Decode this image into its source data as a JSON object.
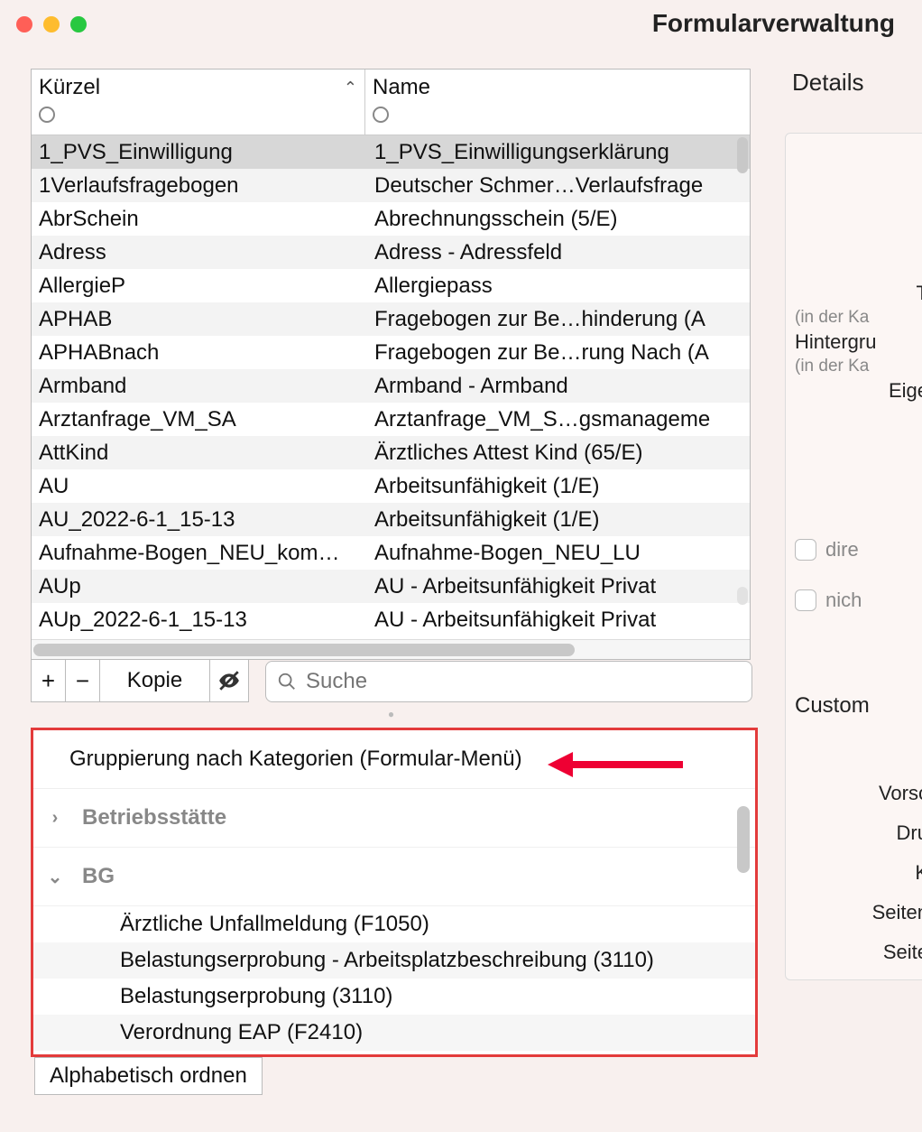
{
  "window": {
    "title": "Formularverwaltung"
  },
  "table": {
    "columns": {
      "kurzel": "Kürzel",
      "name": "Name"
    },
    "rows": [
      {
        "k": "1_PVS_Einwilligung",
        "n": "1_PVS_Einwilligungserklärung",
        "selected": true
      },
      {
        "k": "1Verlaufsfragebogen",
        "n": "Deutscher Schmer…Verlaufsfrage"
      },
      {
        "k": "AbrSchein",
        "n": "Abrechnungsschein (5/E)"
      },
      {
        "k": "Adress",
        "n": "Adress - Adressfeld"
      },
      {
        "k": "AllergieP",
        "n": "Allergiepass"
      },
      {
        "k": "APHAB",
        "n": "Fragebogen zur Be…hinderung (A"
      },
      {
        "k": "APHABnach",
        "n": "Fragebogen zur Be…rung Nach (A"
      },
      {
        "k": "Armband",
        "n": "Armband - Armband"
      },
      {
        "k": "Arztanfrage_VM_SA",
        "n": "Arztanfrage_VM_S…gsmanageme"
      },
      {
        "k": "AttKind",
        "n": "Ärztliches Attest Kind (65/E)"
      },
      {
        "k": "AU",
        "n": "Arbeitsunfähigkeit (1/E)"
      },
      {
        "k": "AU_2022-6-1_15-13",
        "n": "Arbeitsunfähigkeit (1/E)"
      },
      {
        "k": "Aufnahme-Bogen_NEU_kom…",
        "n": "Aufnahme-Bogen_NEU_LU"
      },
      {
        "k": "AUp",
        "n": "AU - Arbeitsunfähigkeit Privat"
      },
      {
        "k": "AUp_2022-6-1_15-13",
        "n": "AU - Arbeitsunfähigkeit Privat"
      }
    ]
  },
  "toolbar": {
    "add": "+",
    "remove": "−",
    "copy": "Kopie",
    "search_placeholder": "Suche"
  },
  "categories": {
    "header": "Gruppierung nach Kategorien (Formular-Menü)",
    "groups": [
      {
        "name": "Betriebsstätte",
        "expanded": false,
        "items": []
      },
      {
        "name": "BG",
        "expanded": true,
        "items": [
          "Ärztliche Unfallmeldung (F1050)",
          "Belastungserprobung - Arbeitsplatzbeschreibung (3110)",
          "Belastungserprobung (3110)",
          "Verordnung EAP (F2410)"
        ]
      }
    ],
    "alpha_button": "Alphabetisch ordnen"
  },
  "details": {
    "heading": "Details",
    "lines": {
      "t": "T",
      "t_sub": "(in der Ka",
      "hg": "Hintergru",
      "hg_sub": "(in der Ka",
      "eig": "Eige",
      "direkt": "dire",
      "nicht": "nich",
      "custom": "Custom",
      "vors": "Vorsc",
      "dru": "Dru",
      "k": "K",
      "seiten1": "Seiten",
      "seiten2": "Seite"
    }
  }
}
